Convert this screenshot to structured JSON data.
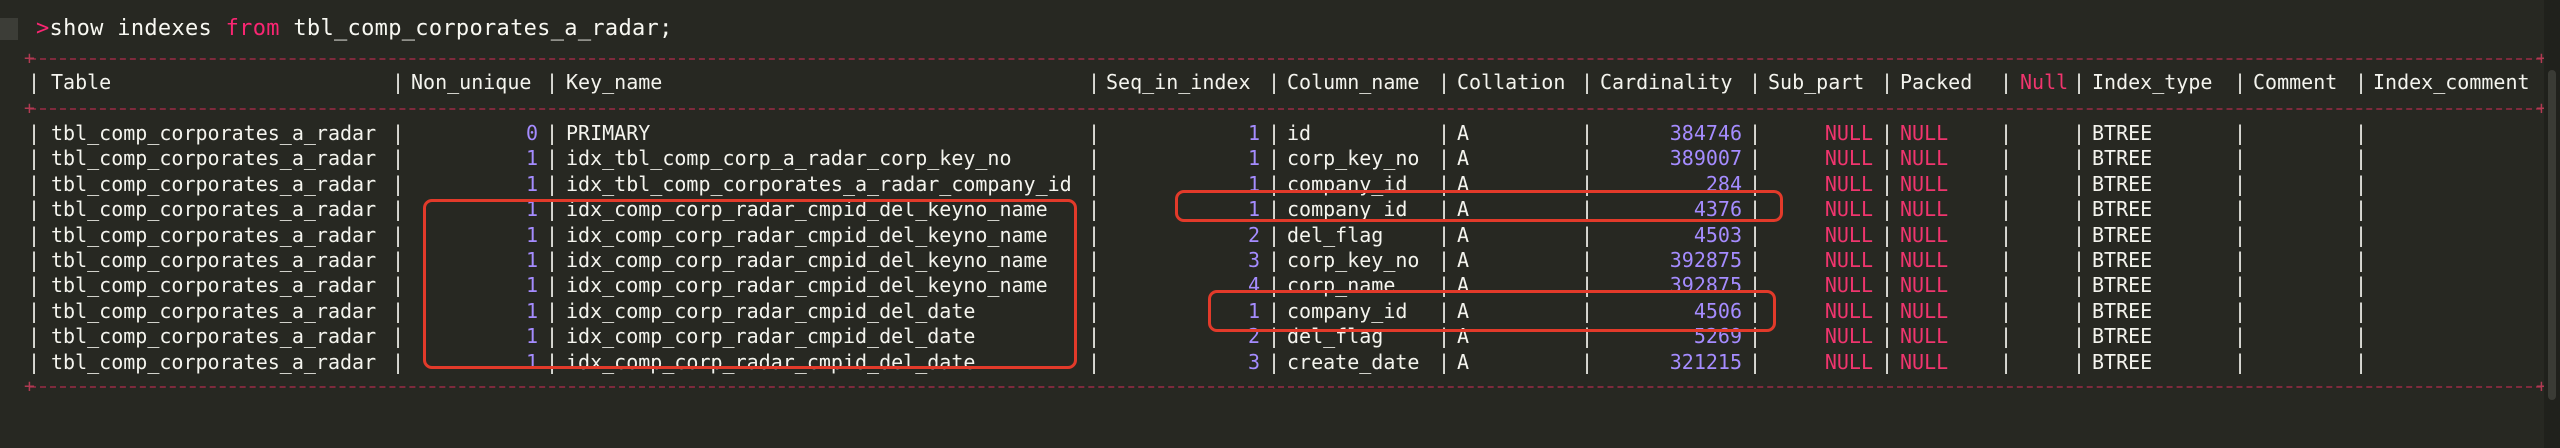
{
  "query": {
    "prompt": ">",
    "command_1": "show indexes ",
    "keyword": "from",
    "command_2": " tbl_comp_corporates_a_radar;"
  },
  "colors": {
    "background": "#272822",
    "number": "#a58cff",
    "null": "#f0356e",
    "highlight": "#e23a2a"
  },
  "columns": [
    "Table",
    "Non_unique",
    "Key_name",
    "Seq_in_index",
    "Column_name",
    "Collation",
    "Cardinality",
    "Sub_part",
    "Packed",
    "Null",
    "Index_type",
    "Comment",
    "Index_comment"
  ],
  "rows": [
    [
      "tbl_comp_corporates_a_radar",
      "0",
      "PRIMARY",
      "1",
      "id",
      "A",
      "384746",
      "NULL",
      "NULL",
      "",
      "BTREE",
      "",
      ""
    ],
    [
      "tbl_comp_corporates_a_radar",
      "1",
      "idx_tbl_comp_corp_a_radar_corp_key_no",
      "1",
      "corp_key_no",
      "A",
      "389007",
      "NULL",
      "NULL",
      "",
      "BTREE",
      "",
      ""
    ],
    [
      "tbl_comp_corporates_a_radar",
      "1",
      "idx_tbl_comp_corporates_a_radar_company_id",
      "1",
      "company_id",
      "A",
      "284",
      "NULL",
      "NULL",
      "",
      "BTREE",
      "",
      ""
    ],
    [
      "tbl_comp_corporates_a_radar",
      "1",
      "idx_comp_corp_radar_cmpid_del_keyno_name",
      "1",
      "company_id",
      "A",
      "4376",
      "NULL",
      "NULL",
      "",
      "BTREE",
      "",
      ""
    ],
    [
      "tbl_comp_corporates_a_radar",
      "1",
      "idx_comp_corp_radar_cmpid_del_keyno_name",
      "2",
      "del_flag",
      "A",
      "4503",
      "NULL",
      "NULL",
      "",
      "BTREE",
      "",
      ""
    ],
    [
      "tbl_comp_corporates_a_radar",
      "1",
      "idx_comp_corp_radar_cmpid_del_keyno_name",
      "3",
      "corp_key_no",
      "A",
      "392875",
      "NULL",
      "NULL",
      "",
      "BTREE",
      "",
      ""
    ],
    [
      "tbl_comp_corporates_a_radar",
      "1",
      "idx_comp_corp_radar_cmpid_del_keyno_name",
      "4",
      "corp_name",
      "A",
      "392875",
      "NULL",
      "NULL",
      "",
      "BTREE",
      "",
      ""
    ],
    [
      "tbl_comp_corporates_a_radar",
      "1",
      "idx_comp_corp_radar_cmpid_del_date",
      "1",
      "company_id",
      "A",
      "4506",
      "NULL",
      "NULL",
      "",
      "BTREE",
      "",
      ""
    ],
    [
      "tbl_comp_corporates_a_radar",
      "1",
      "idx_comp_corp_radar_cmpid_del_date",
      "2",
      "del_flag",
      "A",
      "5269",
      "NULL",
      "NULL",
      "",
      "BTREE",
      "",
      ""
    ],
    [
      "tbl_comp_corporates_a_radar",
      "1",
      "idx_comp_corp_radar_cmpid_del_date",
      "3",
      "create_date",
      "A",
      "321215",
      "NULL",
      "NULL",
      "",
      "BTREE",
      "",
      ""
    ]
  ]
}
